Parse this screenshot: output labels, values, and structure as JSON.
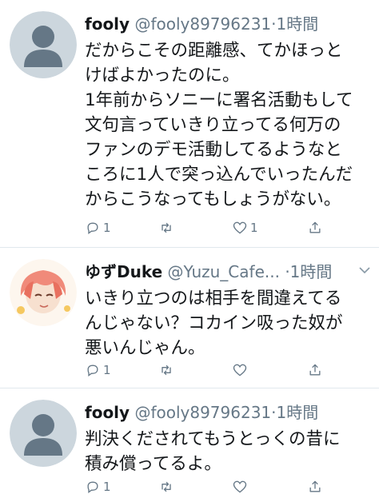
{
  "tweets": [
    {
      "name": "fooly",
      "handle": "@fooly89796231",
      "time": "·1時間",
      "avatar": "default-avatar",
      "lines": [
        "だからこその距離感、てかほっと",
        "けばよかったのに。",
        "1年前からソニーに署名活動もして",
        "文句言っていきり立ってる何万の",
        "ファンのデモ活動してるようなと",
        "ころに1人で突っ込んでいったんだ",
        "からこうなってもしょうがない。"
      ],
      "reply_count": "1",
      "retweet_count": "",
      "like_count": "1"
    },
    {
      "name": "ゆずDuke",
      "handle": "@Yuzu_Cafe...",
      "time": "·1時間",
      "avatar": "anime-avatar",
      "lines": [
        "いきり立つのは相手を間違えてる",
        "んじゃない？コカイン吸った奴が",
        "悪いんじゃん。"
      ],
      "reply_count": "1",
      "retweet_count": "",
      "like_count": ""
    },
    {
      "name": "fooly",
      "handle": "@fooly89796231",
      "time": "·1時間",
      "avatar": "default-avatar",
      "lines": [
        "判決くだされてもうとっくの昔に",
        "積み償ってるよ。"
      ],
      "reply_count": "1",
      "retweet_count": "",
      "like_count": ""
    }
  ],
  "icons": [
    "reply-icon",
    "retweet-icon",
    "like-icon",
    "share-icon",
    "chevron-down-icon"
  ],
  "colors": {
    "text": "#14171a",
    "secondary": "#657786",
    "divider": "#e1e8ed",
    "avatar_bg": "#ccd6dd",
    "avatar_fg": "#657786"
  }
}
